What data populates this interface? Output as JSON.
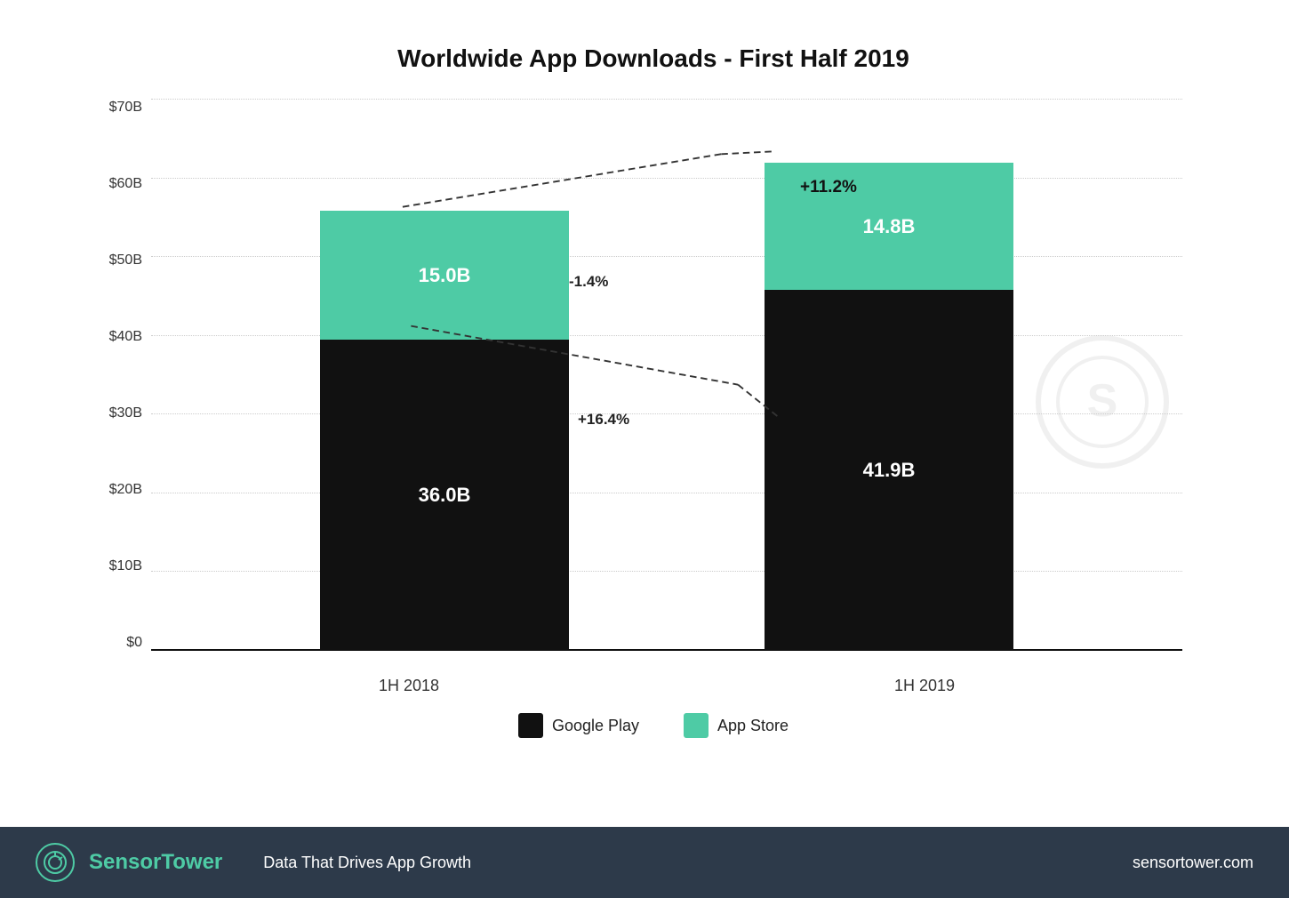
{
  "title": "Worldwide App Downloads - First Half 2019",
  "y_axis": {
    "labels": [
      "$0",
      "$10B",
      "$20B",
      "$30B",
      "$40B",
      "$50B",
      "$60B",
      "$70B"
    ]
  },
  "x_axis": {
    "labels": [
      "1H 2018",
      "1H 2019"
    ]
  },
  "bars": [
    {
      "id": "2018",
      "google_play": {
        "value": 36.0,
        "label": "36.0B",
        "height_pct": 51.4
      },
      "app_store": {
        "value": 15.0,
        "label": "15.0B",
        "height_pct": 21.4
      }
    },
    {
      "id": "2019",
      "google_play": {
        "value": 41.9,
        "label": "41.9B",
        "height_pct": 59.9
      },
      "app_store": {
        "value": 14.8,
        "label": "14.8B",
        "height_pct": 21.1
      }
    }
  ],
  "annotations": {
    "google_play_change": "+16.4%",
    "app_store_change": "-1.4%",
    "total_change": "+11.2%"
  },
  "legend": {
    "items": [
      {
        "label": "Google Play",
        "color": "#111111"
      },
      {
        "label": "App Store",
        "color": "#4ecba5"
      }
    ]
  },
  "footer": {
    "brand": "SensorTower",
    "tagline": "Data That Drives App Growth",
    "url": "sensortower.com"
  }
}
